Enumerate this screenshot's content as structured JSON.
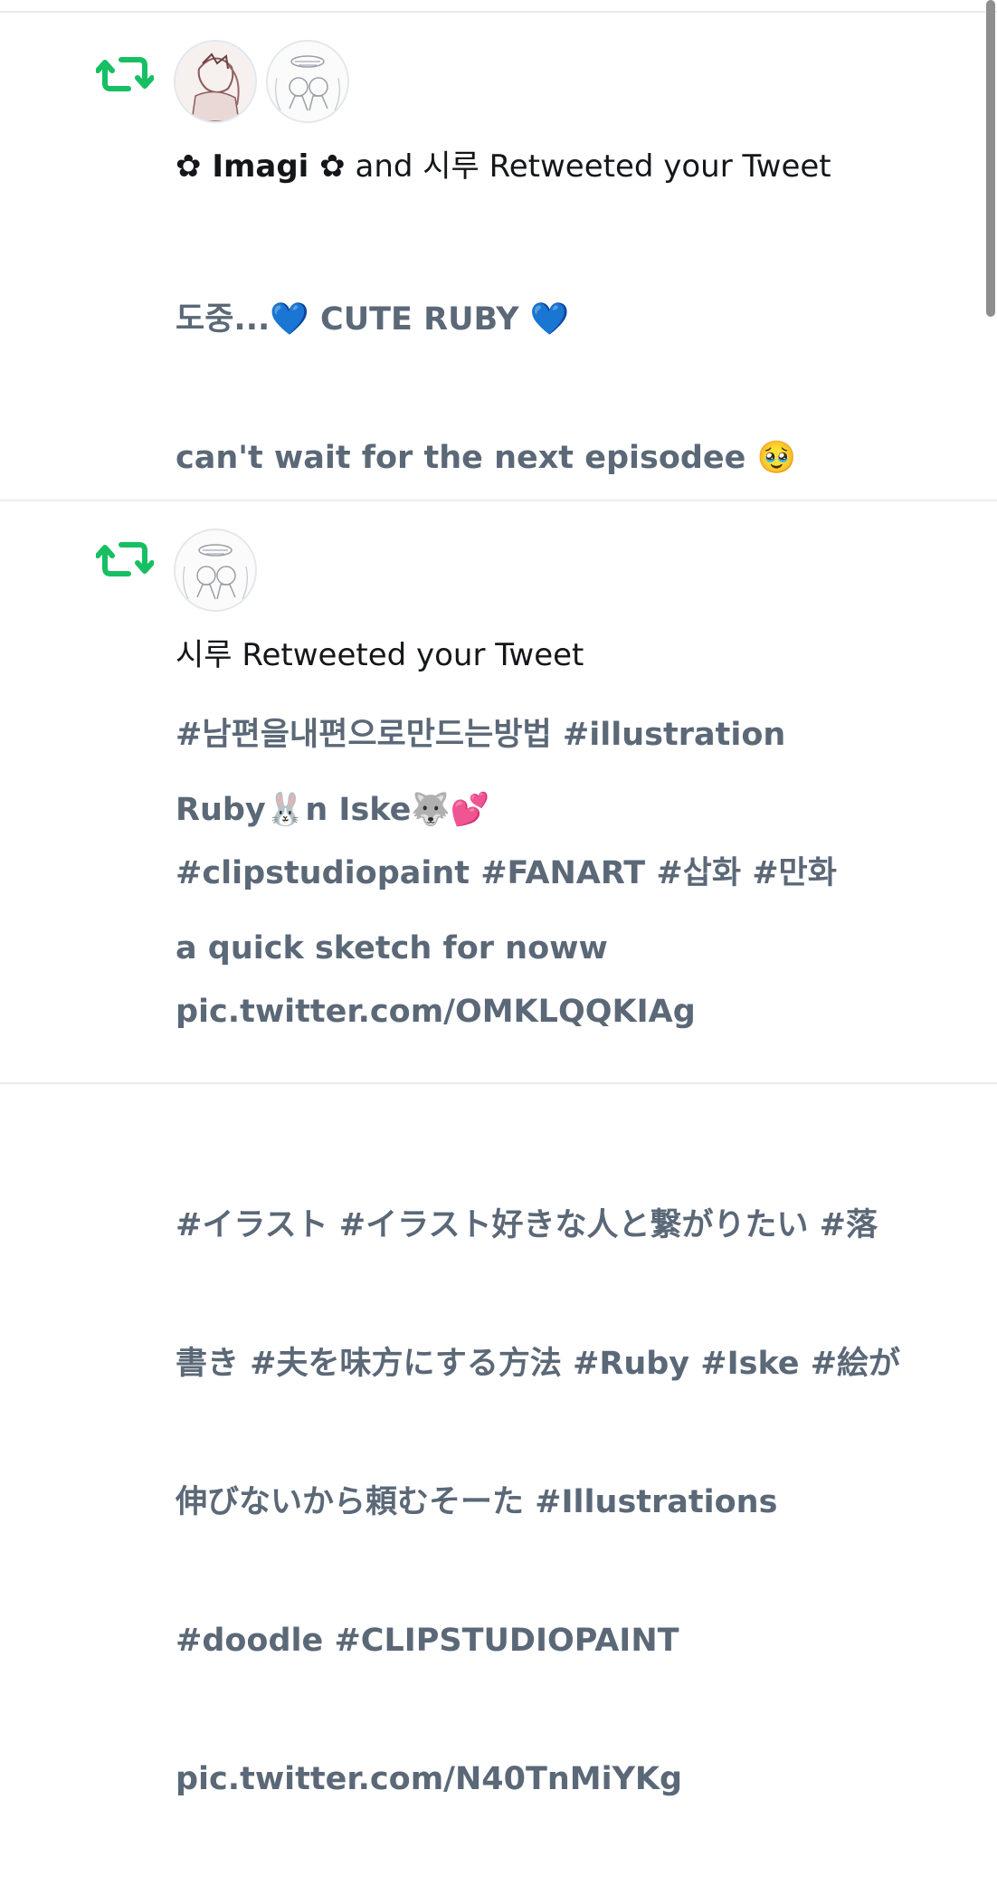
{
  "notifications": [
    {
      "type": "retweet",
      "icon": "retweet-icon",
      "actor1": "✿ Imagi ✿",
      "connector": " and ",
      "actor2": "시루",
      "action": " Retweeted your Tweet",
      "lines": [
        "도중...💙 CUTE RUBY 💙",
        "can't wait for the next episodee 🥹",
        "",
        " #남편을내편으로만드는방법   #illustration",
        "#clipstudiopaint  #FANART   #삽화  #만화",
        "pic.twitter.com/OMKLQQKIAg"
      ]
    },
    {
      "type": "retweet",
      "icon": "retweet-icon",
      "actor": "시루",
      "action": " Retweeted your Tweet",
      "lines": [
        "Ruby🐰n Iske🐺💕",
        "a quick sketch for noww",
        "",
        " #イラスト  #イラスト好きな人と繋がりたい  #落",
        "書き  #夫を味方にする方法  #Ruby  #Iske   #絵が",
        "伸びないから頼むそーた  #Illustrations",
        "#doodle  #CLIPSTUDIOPAINT",
        "pic.twitter.com/N40TnMiYKg"
      ]
    }
  ],
  "colors": {
    "retweet_green": "#17bf63",
    "body_gray": "#5b6877",
    "headline_black": "#14171a"
  }
}
